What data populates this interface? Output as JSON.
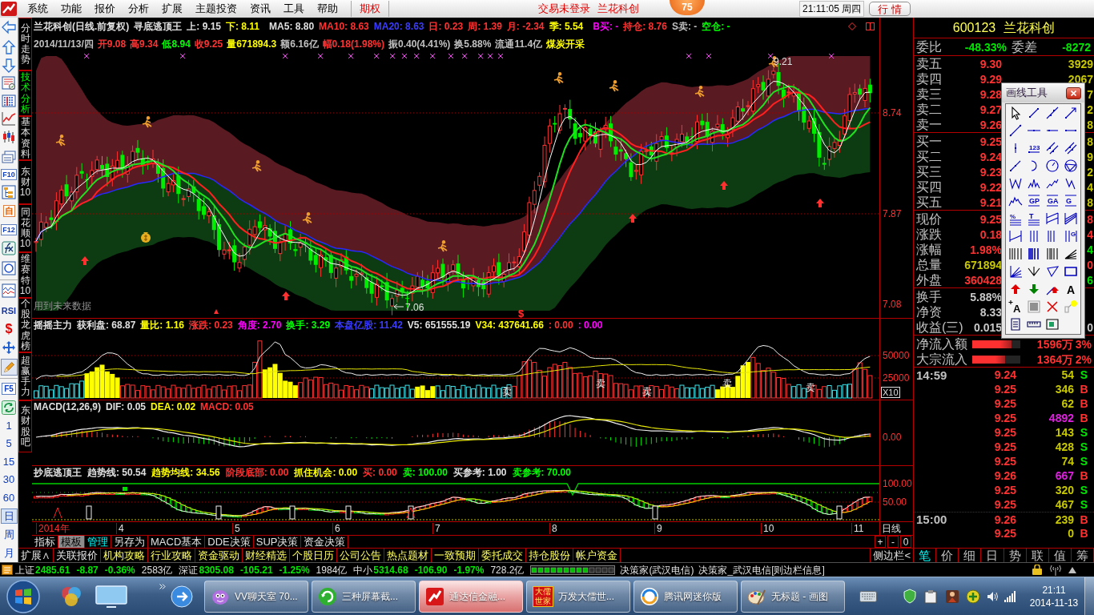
{
  "menu_bar": {
    "items": [
      "系统",
      "功能",
      "报价",
      "分析",
      "扩展",
      "主题投资",
      "资讯",
      "工具",
      "帮助"
    ],
    "option_item": "期权",
    "trade_status": "交易未登录",
    "stock_name": "兰花科创",
    "badge": "75",
    "clock": "21:11:05 周四",
    "quote_button": "行 情"
  },
  "left_toolbar": {
    "labels": [
      "F10",
      "自",
      "F12",
      "RSI",
      "$",
      "F5"
    ],
    "pencil_pressed": true,
    "periods": [
      {
        "label": "1",
        "selected": false
      },
      {
        "label": "5",
        "selected": false
      },
      {
        "label": "15",
        "selected": false
      },
      {
        "label": "30",
        "selected": false
      },
      {
        "label": "60",
        "selected": false
      },
      {
        "label": "日",
        "selected": true
      },
      {
        "label": "周",
        "selected": false
      },
      {
        "label": "月",
        "selected": false
      }
    ]
  },
  "side_tabs": [
    {
      "label": "分时走势",
      "selected": false
    },
    {
      "label": "技术分析",
      "selected": true
    },
    {
      "label": "基本资料",
      "selected": false
    },
    {
      "label": "东财10",
      "selected": false
    },
    {
      "label": "同花顺10",
      "selected": false
    },
    {
      "label": "维赛特10",
      "selected": false
    },
    {
      "label": "个股龙虎榜",
      "selected": false
    },
    {
      "label": "超赢手力",
      "selected": false
    },
    {
      "label": "东财股吧",
      "selected": false
    }
  ],
  "main_chart": {
    "title_row": [
      [
        {
          "text": "兰花科创(日线.前复权)",
          "color": "#e0e0e0"
        },
        {
          "text": "寻底逃顶王",
          "color": "#e0e0e0"
        },
        {
          "text": "上: 9.15",
          "color": "#e0e0e0"
        },
        {
          "text": "下: 8.11",
          "color": "#ffff00"
        }
      ],
      [
        {
          "text": "MA5: 8.80",
          "color": "#e0e0e0"
        },
        {
          "text": "MA10: 8.63",
          "color": "#ff3232"
        },
        {
          "text": "MA20: 8.63",
          "color": "#3c3cff"
        },
        {
          "text": "日: 0.23",
          "color": "#ff3232"
        },
        {
          "text": "周: 1.39",
          "color": "#ff3232"
        },
        {
          "text": "月: -2.34",
          "color": "#ff3232"
        },
        {
          "text": "季: 5.54",
          "color": "#ffff00"
        }
      ],
      [
        {
          "text": "B买: -",
          "color": "#ff00ff"
        },
        {
          "text": "持仓: 8.76",
          "color": "#ff3232"
        },
        {
          "text": "S卖: -",
          "color": "#c0c0c0"
        },
        {
          "text": "空仓: -",
          "color": "#00ff00"
        }
      ]
    ],
    "quote_row": [
      {
        "text": "2014/11/13/四",
        "color": "#c0c0c0"
      },
      {
        "text": "开9.08",
        "color": "#ff3232"
      },
      {
        "text": "高9.34",
        "color": "#ff3232"
      },
      {
        "text": "低8.94",
        "color": "#00ff00"
      },
      {
        "text": "收9.25",
        "color": "#ff3232"
      },
      {
        "text": "量671894.3",
        "color": "#ffff00"
      },
      {
        "text": "额6.16亿",
        "color": "#c0c0c0"
      },
      {
        "text": "幅0.18(1.98%)",
        "color": "#ff3232"
      },
      {
        "text": "振0.40(4.41%)",
        "color": "#c0c0c0"
      },
      {
        "text": "换5.88%",
        "color": "#c0c0c0"
      },
      {
        "text": "流通11.4亿",
        "color": "#c0c0c0"
      },
      {
        "text": "煤炭开采",
        "color": "#ffff00"
      }
    ],
    "high_label": "9.21",
    "low_label": "7.06",
    "note": "用到未来数据",
    "signal": "$",
    "axis": [
      "8.74",
      "7.87",
      "7.08"
    ]
  },
  "volume_panel": {
    "header": [
      {
        "text": "摇摇主力",
        "color": "#e0e0e0"
      },
      {
        "text": "获利盘: 68.87",
        "color": "#e0e0e0"
      },
      {
        "text": "量比: 1.16",
        "color": "#ffff00"
      },
      {
        "text": "涨跌: 0.23",
        "color": "#ff3232"
      },
      {
        "text": "角度: 2.70",
        "color": "#ff00ff"
      },
      {
        "text": "换手: 3.29",
        "color": "#00ff00"
      },
      {
        "text": "本盘亿股: 11.42",
        "color": "#3c3cff"
      },
      {
        "text": "V5: 651555.19",
        "color": "#e0e0e0"
      },
      {
        "text": "V34: 437641.66",
        "color": "#ffff00"
      },
      {
        "text": ": 0.00",
        "color": "#ff3232"
      },
      {
        "text": ": 0.00",
        "color": "#ff00ff"
      }
    ],
    "sell_labels": [
      "卖",
      "卖",
      "卖",
      "卖",
      "卖"
    ],
    "axis": [
      "50000",
      "25000"
    ],
    "scale": "X10"
  },
  "macd_panel": {
    "header": [
      {
        "text": "MACD(12,26,9)",
        "color": "#e0e0e0"
      },
      {
        "text": "DIF: 0.05",
        "color": "#e0e0e0"
      },
      {
        "text": "DEA: 0.02",
        "color": "#ffff00"
      },
      {
        "text": "MACD: 0.05",
        "color": "#ff3232"
      }
    ],
    "axis": [
      "0.00"
    ]
  },
  "signal_panel": {
    "header": [
      {
        "text": "抄底逃顶王",
        "color": "#e0e0e0"
      },
      {
        "text": "趋势线: 50.54",
        "color": "#e0e0e0"
      },
      {
        "text": "趋势均线: 34.56",
        "color": "#ffff00"
      },
      {
        "text": "阶段底部: 0.00",
        "color": "#ff3232"
      },
      {
        "text": "抓住机会: 0.00",
        "color": "#ffff00"
      },
      {
        "text": "买: 0.00",
        "color": "#ff3232"
      },
      {
        "text": "卖: 100.00",
        "color": "#00ff00"
      },
      {
        "text": "买参考: 1.00",
        "color": "#e0e0e0"
      },
      {
        "text": "卖参考: 70.00",
        "color": "#00ff00"
      }
    ],
    "axis": [
      "100.00",
      "50.00"
    ]
  },
  "date_axis": {
    "labels": [
      {
        "text": "2014年",
        "kind": "year"
      },
      {
        "text": "4",
        "kind": "month"
      },
      {
        "text": "5",
        "kind": "month"
      },
      {
        "text": "6",
        "kind": "month"
      },
      {
        "text": "7",
        "kind": "month"
      },
      {
        "text": "8",
        "kind": "month"
      },
      {
        "text": "9",
        "kind": "month"
      },
      {
        "text": "10",
        "kind": "month"
      },
      {
        "text": "11",
        "kind": "month"
      }
    ],
    "period": "日线"
  },
  "template_tabs": {
    "items": [
      {
        "label": "指标",
        "selected": false,
        "kind": "tab"
      },
      {
        "label": "模板",
        "selected": true,
        "kind": "tab"
      },
      {
        "label": "管理",
        "selected": false,
        "kind": "action"
      },
      {
        "label": "另存为",
        "selected": false,
        "kind": "tab"
      },
      {
        "label": "MACD基本",
        "selected": false,
        "kind": "tab"
      },
      {
        "label": "DDE决策",
        "selected": false,
        "kind": "tab"
      },
      {
        "label": "SUP决策",
        "selected": false,
        "kind": "tab"
      },
      {
        "label": "资金决策",
        "selected": false,
        "kind": "tab"
      }
    ],
    "zoom_buttons": [
      "+",
      "-",
      "0"
    ]
  },
  "bottom_tabs": {
    "items": [
      {
        "label": "扩展∧",
        "kind": "system"
      },
      {
        "label": "关联报价",
        "kind": "system"
      },
      {
        "label": "机构攻略",
        "kind": "module"
      },
      {
        "label": "行业攻略",
        "kind": "module"
      },
      {
        "label": "资金驱动",
        "kind": "module"
      },
      {
        "label": "财经精选",
        "kind": "module"
      },
      {
        "label": "个股日历",
        "kind": "module"
      },
      {
        "label": "公司公告",
        "kind": "module"
      },
      {
        "label": "热点题材",
        "kind": "module"
      },
      {
        "label": "一致预期",
        "kind": "module"
      },
      {
        "label": "委托成交",
        "kind": "module"
      },
      {
        "label": "持仓股份",
        "kind": "module"
      },
      {
        "label": "帐户资金",
        "kind": "module"
      }
    ],
    "sidebar_toggle": "侧边栏<"
  },
  "quote_panel": {
    "code": "600123",
    "name": "兰花科创",
    "ratio": {
      "label": "委比",
      "value": "-48.33%",
      "diff_label": "委差",
      "diff": "-8272"
    },
    "asks": [
      {
        "label": "卖五",
        "price": "9.30",
        "volume": "3929"
      },
      {
        "label": "卖四",
        "price": "9.29",
        "volume": "2067"
      },
      {
        "label": "卖三",
        "price": "9.28",
        "volume": "7"
      },
      {
        "label": "卖二",
        "price": "9.27",
        "volume": "2"
      },
      {
        "label": "卖一",
        "price": "9.26",
        "volume": "8"
      }
    ],
    "bids": [
      {
        "label": "买一",
        "price": "9.25",
        "volume": "8"
      },
      {
        "label": "买二",
        "price": "9.24",
        "volume": "9"
      },
      {
        "label": "买三",
        "price": "9.23",
        "volume": "2"
      },
      {
        "label": "买四",
        "price": "9.22",
        "volume": "4"
      },
      {
        "label": "买五",
        "price": "9.21",
        "volume": "8"
      }
    ],
    "stats": [
      {
        "label": "现价",
        "value": {
          "text": "9.25",
          "color": "#ff3232"
        },
        "side": {
          "text": "8",
          "color": "#ff3232"
        }
      },
      {
        "label": "涨跌",
        "value": {
          "text": "0.18",
          "color": "#ff3232"
        },
        "side": {
          "text": "4",
          "color": "#ff3232"
        }
      },
      {
        "label": "涨幅",
        "value": {
          "text": "1.98%",
          "color": "#ff3232"
        },
        "side": {
          "text": "4",
          "color": "#00e600"
        }
      },
      {
        "label": "总量",
        "value": {
          "text": "671894",
          "color": "#c8c800"
        },
        "side": {
          "text": "0",
          "color": "#ff3232"
        }
      },
      {
        "label": "外盘",
        "value": {
          "text": "360428",
          "color": "#ff3232"
        },
        "side": {
          "text": "6",
          "color": "#00e600"
        }
      }
    ],
    "fundamentals": [
      {
        "label": "换手",
        "value": "5.88%"
      },
      {
        "label": "净资",
        "value": "8.33"
      },
      {
        "label": "收益(三)",
        "value": "0.015",
        "side": "0"
      }
    ],
    "flows": [
      {
        "label": "净流入额",
        "level": 0.82,
        "value": "1596万",
        "percent": "3%"
      },
      {
        "label": "大宗流入",
        "level": 0.68,
        "value": "1364万",
        "percent": "2%"
      }
    ],
    "ticks": [
      {
        "time": "14:59",
        "price": "9.24",
        "volume": "54",
        "flag": "S",
        "kind": "sell",
        "large": false
      },
      {
        "price": "9.25",
        "volume": "346",
        "flag": "B",
        "kind": "buy",
        "large": false
      },
      {
        "price": "9.25",
        "volume": "62",
        "flag": "B",
        "kind": "buy",
        "large": false
      },
      {
        "price": "9.25",
        "volume": "4892",
        "flag": "B",
        "kind": "buy",
        "large": true
      },
      {
        "price": "9.25",
        "volume": "143",
        "flag": "S",
        "kind": "sell",
        "large": false
      },
      {
        "price": "9.25",
        "volume": "428",
        "flag": "S",
        "kind": "sell",
        "large": false
      },
      {
        "price": "9.25",
        "volume": "74",
        "flag": "S",
        "kind": "sell",
        "large": false
      },
      {
        "price": "9.26",
        "volume": "667",
        "flag": "B",
        "kind": "buy",
        "large": true
      },
      {
        "price": "9.25",
        "volume": "320",
        "flag": "S",
        "kind": "sell",
        "large": false
      },
      {
        "price": "9.25",
        "volume": "467",
        "flag": "S",
        "kind": "sell",
        "large": false
      },
      {
        "time": "15:00",
        "price": "9.26",
        "volume": "239",
        "flag": "B",
        "kind": "buy",
        "large": false
      },
      {
        "price": "9.25",
        "volume": "0",
        "flag": "B",
        "kind": "buy",
        "large": false
      }
    ],
    "tabs": [
      {
        "label": "笔",
        "selected": true
      },
      {
        "label": "价",
        "selected": false
      },
      {
        "label": "细",
        "selected": false
      },
      {
        "label": "日",
        "selected": false
      },
      {
        "label": "势",
        "selected": false
      },
      {
        "label": "联",
        "selected": false
      },
      {
        "label": "值",
        "selected": false
      },
      {
        "label": "筹",
        "selected": false
      }
    ]
  },
  "drawing_tools": {
    "title": "画线工具",
    "glyph_labels": [
      "123",
      "GP",
      "GA",
      "G",
      "%",
      "T",
      "G",
      "A",
      "A"
    ]
  },
  "status_bar": {
    "indices": [
      {
        "name": "上证",
        "value": "2485.61",
        "change": "-8.87",
        "percent": "-0.36%",
        "amount": "2583亿",
        "color": "#00e600"
      },
      {
        "name": "深证",
        "value": "8305.08",
        "change": "-105.21",
        "percent": "-1.25%",
        "amount": "1984亿",
        "color": "#00e600"
      },
      {
        "name": "中小",
        "value": "5314.68",
        "change": "-106.90",
        "percent": "-1.97%",
        "amount": "728.2亿",
        "color": "#00e600"
      }
    ],
    "server": "决策家(武汉电信)",
    "info": "决策家_武汉电信[则边栏信息]"
  },
  "taskbar": {
    "tasks": [
      {
        "label": "VV聊天室 70...",
        "selected": false
      },
      {
        "label": "三种屏幕截...",
        "selected": false
      },
      {
        "label": "通达信金融...",
        "selected": true
      },
      {
        "label": "万发大儒世...",
        "selected": false,
        "icon_text": "大儒世家"
      },
      {
        "label": "腾讯网迷你版",
        "selected": false
      },
      {
        "label": "无标题 - 画图",
        "selected": false
      }
    ],
    "time": "21:11",
    "date": "2014-11-13"
  }
}
